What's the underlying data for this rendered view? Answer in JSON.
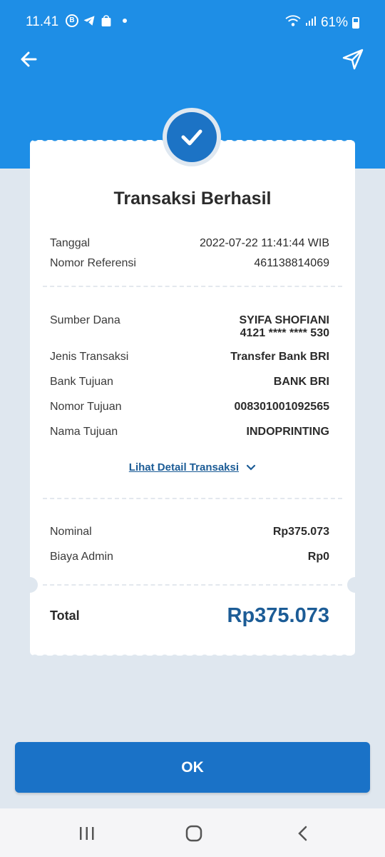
{
  "status_bar": {
    "time": "11.41",
    "notif_icons": [
      "b-icon",
      "telegram-icon",
      "shop-icon"
    ],
    "battery_percent": "61%"
  },
  "header": {
    "back_icon": "arrow-left-icon",
    "share_icon": "send-icon"
  },
  "receipt": {
    "title": "Transaksi Berhasil",
    "date_label": "Tanggal",
    "date_value": "2022-07-22 11:41:44 WIB",
    "ref_label": "Nomor Referensi",
    "ref_value": "461138814069",
    "source_label": "Sumber Dana",
    "source_name": "SYIFA SHOFIANI",
    "source_account": "4121 **** **** 530",
    "type_label": "Jenis Transaksi",
    "type_value": "Transfer Bank BRI",
    "bank_label": "Bank Tujuan",
    "bank_value": "BANK BRI",
    "dest_number_label": "Nomor Tujuan",
    "dest_number_value": "008301001092565",
    "dest_name_label": "Nama Tujuan",
    "dest_name_value": "INDOPRINTING",
    "detail_link": "Lihat Detail Transaksi",
    "nominal_label": "Nominal",
    "nominal_value": "Rp375.073",
    "admin_label": "Biaya Admin",
    "admin_value": "Rp0",
    "total_label": "Total",
    "total_value": "Rp375.073"
  },
  "ok_button": "OK",
  "colors": {
    "primary_blue": "#1e8ee6",
    "button_blue": "#1a72c7",
    "total_blue": "#1c5c96",
    "background": "#dfe7ef"
  }
}
